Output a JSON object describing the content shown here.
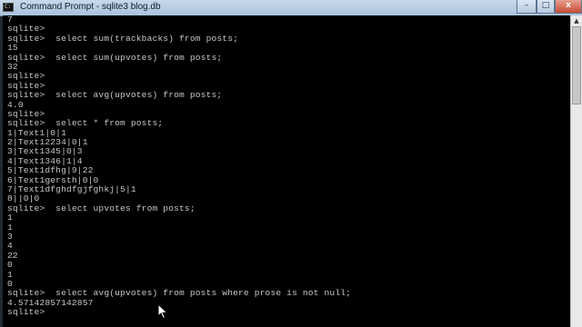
{
  "window": {
    "title": "Command Prompt - sqlite3  blog.db",
    "system_icon": "console-icon",
    "minimize_glyph": "–",
    "maximize_glyph": "□",
    "close_glyph": "x"
  },
  "console": {
    "lines": [
      "7",
      "sqlite>",
      "sqlite>  select sum(trackbacks) from posts;",
      "15",
      "sqlite>  select sum(upvotes) from posts;",
      "32",
      "sqlite>",
      "sqlite>",
      "sqlite>  select avg(upvotes) from posts;",
      "4.0",
      "sqlite>",
      "sqlite>  select * from posts;",
      "1|Text1|0|1",
      "2|Text12234|0|1",
      "3|Text1345|0|3",
      "4|Text1346|1|4",
      "5|Text1dfhg|9|22",
      "6|Text1gersth|0|0",
      "7|Text1dfghdfgjfghkj|5|1",
      "8||0|0",
      "sqlite>  select upvotes from posts;",
      "1",
      "1",
      "3",
      "4",
      "22",
      "0",
      "1",
      "0",
      "sqlite>  select avg(upvotes) from posts where prose is not null;",
      "4.57142857142857",
      "sqlite>"
    ]
  },
  "scrollbar": {
    "up_arrow": "▲"
  }
}
